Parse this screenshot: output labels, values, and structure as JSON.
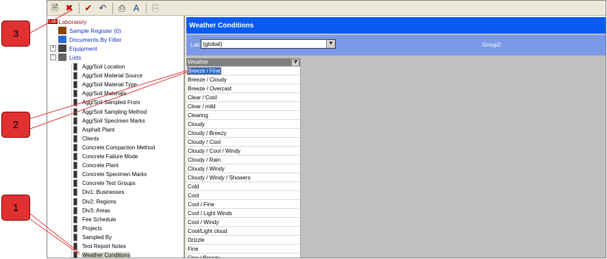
{
  "toolbar": {
    "buttons": [
      {
        "name": "new-icon",
        "glyph": "🗎"
      },
      {
        "name": "delete-icon",
        "glyph": "✖"
      },
      {
        "name": "sep"
      },
      {
        "name": "check-icon",
        "glyph": "✔"
      },
      {
        "name": "undo-icon",
        "glyph": "↶"
      },
      {
        "name": "sep"
      },
      {
        "name": "print-icon",
        "glyph": "⎙"
      },
      {
        "name": "spellcheck-icon",
        "glyph": "A"
      },
      {
        "name": "sep"
      },
      {
        "name": "copy-icon",
        "glyph": "⎘"
      }
    ]
  },
  "tree": {
    "root": {
      "badge": "Lab",
      "label": "Laboratory"
    },
    "nodes": [
      {
        "label": "Sample Register (0)",
        "icon": "sample-register-icon"
      },
      {
        "label": "Documents By Filter",
        "icon": "documents-icon"
      },
      {
        "label": "Equipment",
        "icon": "equipment-icon",
        "expander": "+"
      },
      {
        "label": "Lists",
        "icon": "lists-icon",
        "expander": "−"
      }
    ],
    "lists": [
      "Agg/Soil Location",
      "Agg/Soil Material Source",
      "Agg/Soil Material Type",
      "Agg/Soil Materials",
      "Agg/Soil Sampled From",
      "Agg/Soil Sampling Method",
      "Agg/Soil Specimen Marks",
      "Asphalt Plant",
      "Clients",
      "Concrete Compaction Method",
      "Concrete Failure Mode",
      "Concrete Plant",
      "Concrete Specimen Marks",
      "Concrete Test Groups",
      "Div1: Businesses",
      "Div2: Regions",
      "Div3: Areas",
      "Fee Schedule",
      "Projects",
      "Sampled By",
      "Test Report Notes",
      "Weather Conditions"
    ]
  },
  "content": {
    "title": "Weather Conditions",
    "lab_label": "Lab:",
    "lab_value": "(global)",
    "group2_label": "Group2:",
    "grid_header": "Weather",
    "rows": [
      "Breeze / Fine",
      "Breeze / Cloudy",
      "Breeze / Overcast",
      "Clear / Cool",
      "Clear / mild",
      "Clearing",
      "Cloudy",
      "Cloudy / Breezy",
      "Cloudy / Cool",
      "Cloudy / Cool / Windy",
      "Cloudy / Rain",
      "Cloudy / Windy",
      "Cloudy / Windy / Showers",
      "Cold",
      "Cool",
      "Cool / Fine",
      "Cool / Light Winds",
      "Cool / Windy",
      "Cool/Light cloud",
      "Drizzle",
      "Fine",
      "Fine / Breezy"
    ]
  },
  "callouts": [
    "1",
    "2",
    "3"
  ],
  "colors": {
    "accent": "#0a5cf0",
    "filter": "#7c99e8",
    "callout": "#e03030",
    "selection": "#316ac5"
  }
}
